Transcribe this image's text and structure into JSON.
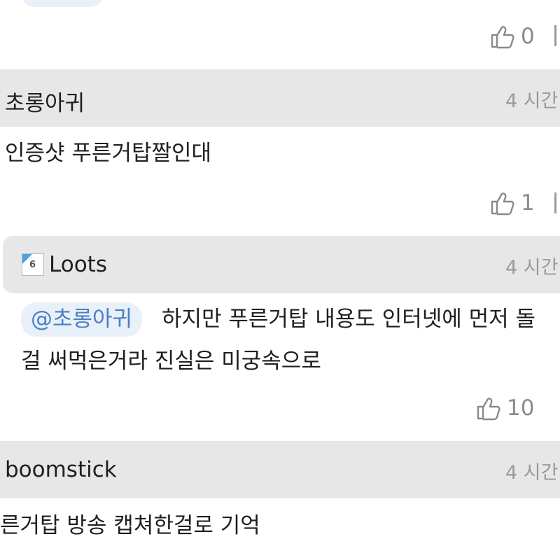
{
  "previous_comment": {
    "likes": "0"
  },
  "comments": [
    {
      "author": "초롱아귀",
      "time": "4 시간",
      "text": "인증샷 푸른거탑짤인대",
      "likes": "1"
    },
    {
      "author": "Loots",
      "badge": "6",
      "time": "4 시간",
      "mention": "@초롱아귀",
      "text_line1": "하지만 푸른거탑 내용도 인터넷에 먼저 돌",
      "text_line2": "걸 써먹은거라 진실은 미궁속으로",
      "likes": "10"
    },
    {
      "author": "boomstick",
      "time": "4 시간",
      "text": "른거탑 방송 캡쳐한걸로 기억"
    }
  ],
  "icons": {
    "like": "thumbs-up-icon"
  },
  "colors": {
    "header_bg": "#e7e7e7",
    "mention_bg": "#e8f0f9",
    "mention_text": "#4a7fc1",
    "muted": "#8a8a8a"
  }
}
